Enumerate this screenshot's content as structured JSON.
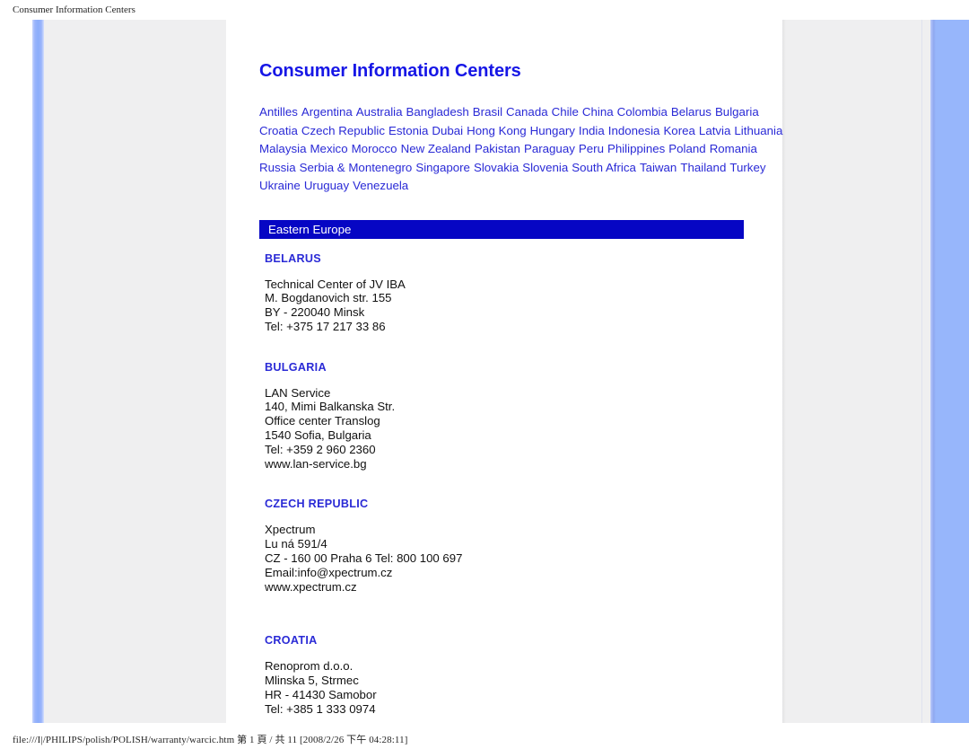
{
  "print": {
    "header_title": "Consumer Information Centers",
    "footer_text": "file:///I|/PHILIPS/polish/POLISH/warranty/warcic.htm 第 1 頁 / 共 11 [2008/2/26 下午 04:28:11]"
  },
  "colors": {
    "title_blue": "#1616e6",
    "link_blue": "#2a2ad6",
    "region_bar_blue": "#0606c4",
    "rail_blue": "#97b6fb",
    "page_grey": "#efeff0"
  },
  "page": {
    "title": "Consumer Information Centers",
    "country_links": [
      "Antilles",
      "Argentina",
      "Australia",
      "Bangladesh",
      "Brasil",
      "Canada",
      "Chile",
      "China",
      "Colombia",
      "Belarus",
      "Bulgaria",
      "Croatia",
      "Czech Republic",
      "Estonia",
      "Dubai",
      "Hong Kong",
      "Hungary",
      "India",
      "Indonesia",
      "Korea",
      "Latvia",
      "Lithuania",
      "Malaysia",
      "Mexico",
      "Morocco",
      "New Zealand",
      "Pakistan",
      "Paraguay",
      "Peru",
      "Philippines",
      "Poland",
      "Romania",
      "Russia",
      "Serbia & Montenegro",
      "Singapore",
      "Slovakia",
      "Slovenia",
      "South Africa",
      "Taiwan",
      "Thailand",
      "Turkey",
      "Ukraine",
      "Uruguay",
      "Venezuela"
    ],
    "region_bar": "Eastern Europe",
    "entries": [
      {
        "country": "BELARUS",
        "lines": [
          "Technical Center of JV IBA",
          "M. Bogdanovich str. 155",
          "BY - 220040 Minsk",
          "Tel: +375 17 217 33 86"
        ]
      },
      {
        "country": "BULGARIA",
        "lines": [
          "LAN Service",
          "140, Mimi Balkanska Str.",
          "Office center Translog",
          "1540 Sofia, Bulgaria",
          "Tel: +359 2 960 2360",
          "www.lan-service.bg"
        ]
      },
      {
        "country": "CZECH REPUBLIC",
        "lines": [
          "Xpectrum",
          "Lu ná 591/4",
          "CZ - 160 00 Praha 6 Tel: 800 100 697",
          "Email:info@xpectrum.cz",
          "www.xpectrum.cz"
        ]
      },
      {
        "country": "CROATIA",
        "lines": [
          "Renoprom d.o.o.",
          "Mlinska 5, Strmec",
          "HR - 41430 Samobor",
          "Tel: +385 1 333 0974"
        ]
      }
    ]
  }
}
